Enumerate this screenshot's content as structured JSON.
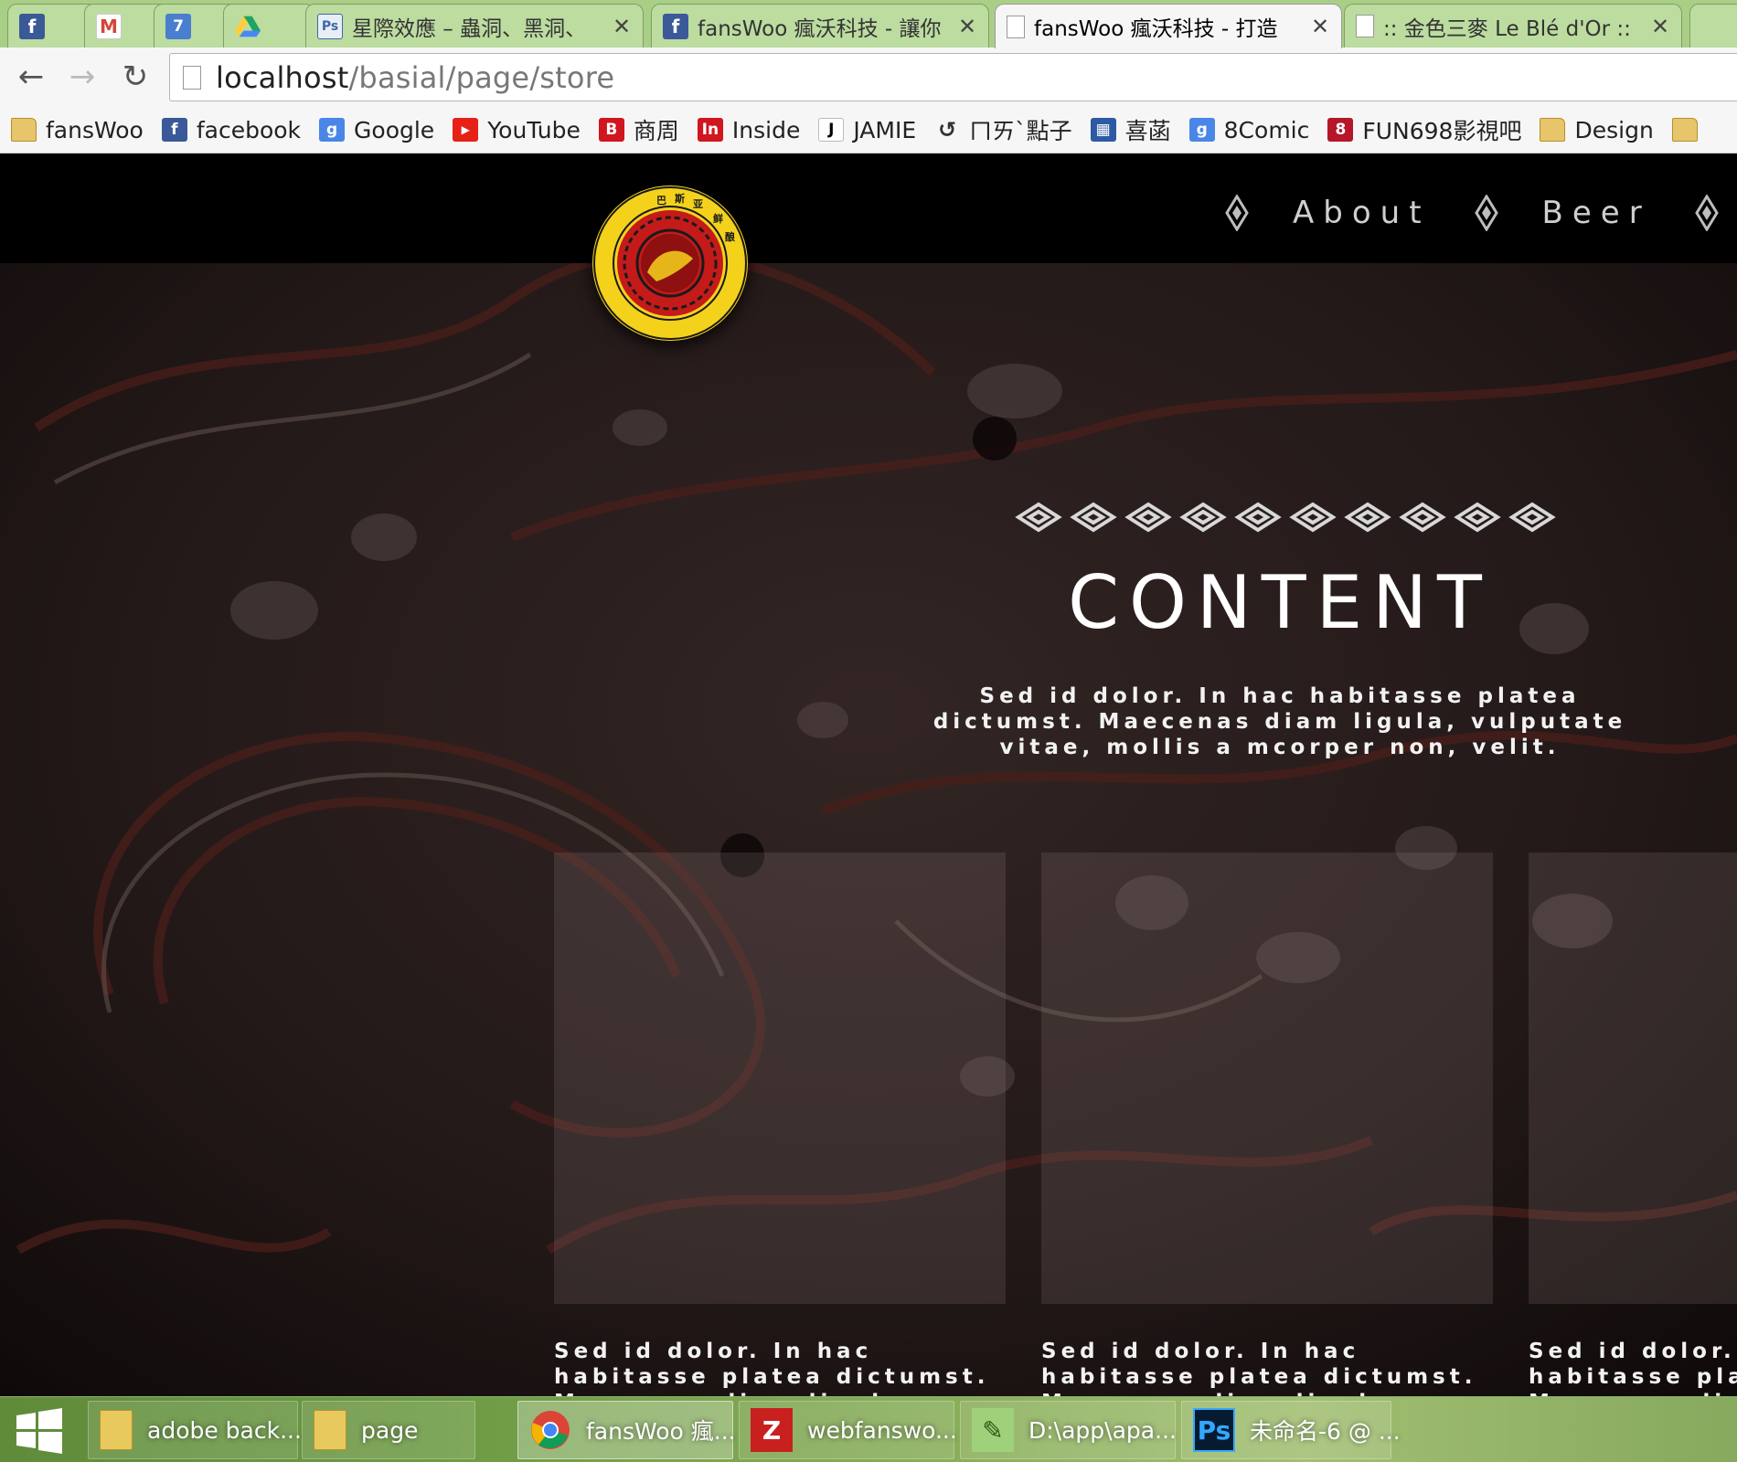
{
  "browser": {
    "tabs": [
      {
        "title": "",
        "icon": "facebook-icon",
        "glyph": "f",
        "active": false,
        "closable": false
      },
      {
        "title": "",
        "icon": "gmail-icon",
        "glyph": "M",
        "active": false,
        "closable": false
      },
      {
        "title": "",
        "icon": "calendar-icon",
        "glyph": "7",
        "active": false,
        "closable": false
      },
      {
        "title": "",
        "icon": "google-drive-icon",
        "glyph": "",
        "active": false,
        "closable": false
      },
      {
        "title": "星際效應 – 蟲洞、黑洞、",
        "icon": "photoshop-doc-icon",
        "glyph": "Ps",
        "active": false,
        "closable": true
      },
      {
        "title": "fansWoo 瘋沃科技 - 讓你",
        "icon": "facebook-icon",
        "glyph": "f",
        "active": false,
        "closable": true
      },
      {
        "title": "fansWoo 瘋沃科技 - 打造",
        "icon": "page-icon",
        "glyph": "",
        "active": true,
        "closable": true
      },
      {
        "title": ":: 金色三麥 Le Blé d'Or ::",
        "icon": "page-icon",
        "glyph": "",
        "active": false,
        "closable": true
      }
    ],
    "url_host": "localhost",
    "url_path": "/basial/page/store",
    "bookmarks": [
      {
        "label": "fansWoo",
        "icon": "folder-icon",
        "glyph": ""
      },
      {
        "label": "facebook",
        "icon": "facebook-icon",
        "glyph": "f"
      },
      {
        "label": "Google",
        "icon": "google-icon",
        "glyph": "g"
      },
      {
        "label": "YouTube",
        "icon": "youtube-icon",
        "glyph": "▶"
      },
      {
        "label": "商周",
        "icon": "business-weekly-icon",
        "glyph": "B"
      },
      {
        "label": "Inside",
        "icon": "inside-icon",
        "glyph": "In"
      },
      {
        "label": "JAMIE",
        "icon": "jamie-icon",
        "glyph": "J"
      },
      {
        "label": "ㄇㄞˋ點子",
        "icon": "spiral-icon",
        "glyph": "↺"
      },
      {
        "label": "喜菡",
        "icon": "grid-icon",
        "glyph": "▦"
      },
      {
        "label": "8Comic",
        "icon": "google-icon",
        "glyph": "g"
      },
      {
        "label": "FUN698影視吧",
        "icon": "fun698-icon",
        "glyph": "8"
      },
      {
        "label": "Design",
        "icon": "folder-icon",
        "glyph": ""
      },
      {
        "label": "",
        "icon": "folder-icon",
        "glyph": ""
      }
    ]
  },
  "site": {
    "nav": [
      {
        "label": "About"
      },
      {
        "label": "Beer"
      }
    ],
    "section_title": "CONTENT",
    "intro": "Sed id dolor. In hac habitasse platea dictumst. Maecenas diam ligula, vulputate vitae, mollis a mcorper non, velit.",
    "cards": [
      {
        "text": "Sed id dolor. In hac\nhabitasse platea dictumst.\nMaecenas diam ligula,\nvulputate vitae, mollis a\nmcorper non, velit."
      },
      {
        "text": "Sed id dolor. In hac\nhabitasse platea dictumst.\nMaecenas diam ligula,\nvulputate vitae, mollis a\nmcorper non, velit."
      },
      {
        "text": "Sed id dolor. In hac\nhabitasse platea dictumst.\nMaecenas diam ligula,\nvulputate vitae, mollis a\nmcorper non, velit."
      }
    ],
    "colors": {
      "header": "#000000",
      "text": "#ffffff",
      "nav_text": "#cfcfcf",
      "logo_yellow": "#f4d21c",
      "logo_red": "#c41a1a"
    }
  },
  "taskbar": {
    "items": [
      {
        "label": "adobe back...",
        "icon": "folder-icon",
        "glyph": "",
        "active": false
      },
      {
        "label": "page",
        "icon": "folder-icon",
        "glyph": "",
        "active": false
      },
      {
        "label": "fansWoo 瘋...",
        "icon": "chrome-icon",
        "glyph": "",
        "active": true
      },
      {
        "label": "webfanswo...",
        "icon": "filezilla-icon",
        "glyph": "Z",
        "active": false
      },
      {
        "label": "D:\\app\\apa...",
        "icon": "notepad-icon",
        "glyph": "✎",
        "active": false
      },
      {
        "label": "未命名-6 @ ...",
        "icon": "photoshop-icon",
        "glyph": "Ps",
        "active": false
      }
    ]
  }
}
